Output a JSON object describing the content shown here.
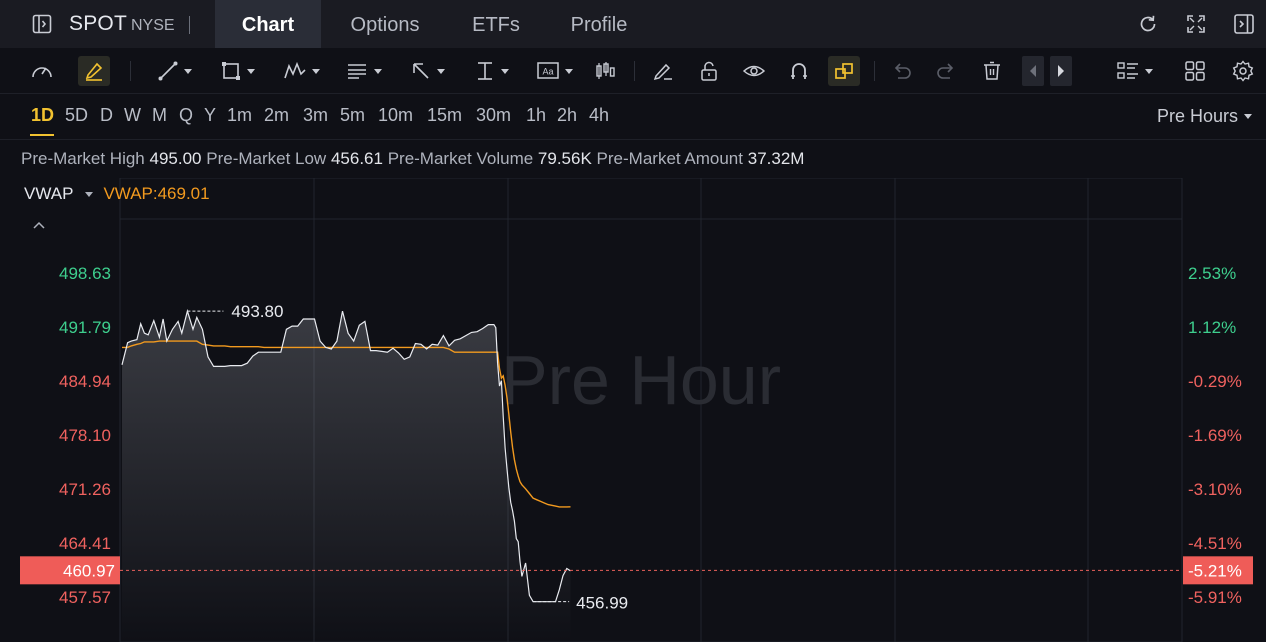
{
  "header": {
    "ticker": "SPOT",
    "exchange": "NYSE",
    "tabs": [
      {
        "label": "Chart",
        "active": true
      },
      {
        "label": "Options",
        "active": false
      },
      {
        "label": "ETFs",
        "active": false
      },
      {
        "label": "Profile",
        "active": false
      }
    ]
  },
  "toolbar": {
    "tools": [
      "speed-icon",
      "highlight-pen-icon",
      "line-icon",
      "rectangle-icon",
      "pattern-icon",
      "fib-icon",
      "arrow-icon",
      "measure-icon",
      "text-icon",
      "candles-icon",
      "brush-icon",
      "lock-icon",
      "eye-icon",
      "magnet-icon",
      "link-icon",
      "undo-icon",
      "redo-icon",
      "trash-icon",
      "prev-icon",
      "next-icon",
      "list-icon",
      "grid-icon",
      "settings-icon"
    ]
  },
  "timeframes": {
    "items": [
      "1D",
      "5D",
      "D",
      "W",
      "M",
      "Q",
      "Y",
      "1m",
      "2m",
      "3m",
      "5m",
      "10m",
      "15m",
      "30m",
      "1h",
      "2h",
      "4h"
    ],
    "active": "1D",
    "session": "Pre Hours"
  },
  "premarket": {
    "high_label": "Pre-Market High",
    "high": "495.00",
    "low_label": "Pre-Market Low",
    "low": "456.61",
    "volume_label": "Pre-Market Volume",
    "volume": "79.56K",
    "amount_label": "Pre-Market Amount",
    "amount": "37.32M"
  },
  "indicator": {
    "name": "VWAP",
    "value_text": "VWAP:469.01"
  },
  "chart_data": {
    "type": "line",
    "watermark": "Pre Hour",
    "y_ticks": [
      "498.63",
      "491.79",
      "484.94",
      "478.10",
      "471.26",
      "464.41",
      "457.57"
    ],
    "pct_ticks": [
      "2.53%",
      "1.12%",
      "-0.29%",
      "-1.69%",
      "-3.10%",
      "-4.51%",
      "-5.91%"
    ],
    "ylim": [
      455,
      503
    ],
    "ref_close": 486.33,
    "current_price": "460.97",
    "current_pct": "-5.21%",
    "high_annotation": "493.80",
    "low_annotation": "456.99",
    "colors": {
      "price": "#e9ebf0",
      "vwap": "#f29a1f",
      "up": "#3ecf8e",
      "down": "#f0625f",
      "grid": "#22252e"
    },
    "x": [
      0,
      3,
      5,
      8,
      10,
      12,
      14,
      17,
      20,
      22,
      24,
      27,
      30,
      32,
      35,
      38,
      40,
      43,
      46,
      49,
      52,
      55,
      58,
      61,
      64,
      67,
      70,
      73,
      76,
      79,
      82,
      85,
      88,
      91,
      94,
      97,
      100,
      103,
      106,
      109,
      112,
      115,
      118,
      121,
      124,
      127,
      130,
      133,
      136,
      139,
      142,
      145,
      148,
      151,
      154,
      157,
      160,
      163,
      166,
      169,
      172,
      175,
      178,
      181,
      184,
      187,
      190,
      193,
      196,
      199,
      200,
      201,
      202,
      203,
      204,
      205,
      206,
      207,
      208,
      209,
      210,
      211,
      212,
      213,
      214,
      216,
      218,
      220,
      222,
      224,
      226,
      228,
      230,
      232,
      234,
      236,
      238,
      240
    ],
    "price": [
      487.0,
      489.8,
      490.0,
      490.2,
      492.2,
      491.0,
      490.8,
      492.6,
      490.5,
      492.8,
      490.0,
      491.5,
      492.5,
      491.0,
      493.8,
      491.5,
      493.0,
      491.5,
      488.0,
      486.8,
      486.8,
      486.8,
      486.9,
      486.9,
      486.9,
      487.2,
      488.1,
      488.6,
      488.6,
      488.6,
      488.6,
      488.6,
      491.5,
      491.9,
      491.9,
      492.8,
      492.8,
      492.8,
      490.0,
      489.2,
      489.0,
      490.0,
      493.8,
      491.0,
      490.0,
      492.0,
      492.5,
      488.8,
      488.8,
      488.7,
      488.6,
      489.1,
      488.5,
      487.7,
      488.0,
      489.7,
      489.6,
      489.0,
      489.6,
      489.5,
      490.7,
      489.4,
      490.1,
      490.3,
      490.7,
      491.1,
      491.2,
      491.6,
      492.1,
      492.1,
      491.7,
      487.2,
      484.3,
      485.0,
      480.5,
      476.5,
      473.8,
      471.5,
      469.6,
      468.5,
      467.2,
      465.0,
      464.6,
      462.1,
      460.2,
      461.9,
      457.8,
      457.0,
      457.0,
      457.0,
      457.0,
      457.0,
      457.0,
      457.0,
      458.5,
      460.3,
      461.2,
      460.9
    ],
    "vwap": [
      489.2,
      489.2,
      489.4,
      489.6,
      489.7,
      489.9,
      489.9,
      489.9,
      490.0,
      490.0,
      490.0,
      490.0,
      490.0,
      490.0,
      490.0,
      490.0,
      490.0,
      489.6,
      489.5,
      489.4,
      489.4,
      489.4,
      489.3,
      489.3,
      489.3,
      489.3,
      489.3,
      489.3,
      489.2,
      489.2,
      489.2,
      489.2,
      489.2,
      489.2,
      489.2,
      489.2,
      489.2,
      489.2,
      489.2,
      489.2,
      489.2,
      489.2,
      489.2,
      489.2,
      489.2,
      489.2,
      489.2,
      489.2,
      489.2,
      489.2,
      489.2,
      489.2,
      489.2,
      489.2,
      489.2,
      489.2,
      489.2,
      489.2,
      489.2,
      489.2,
      489.2,
      489.0,
      488.6,
      488.6,
      488.6,
      488.6,
      488.6,
      488.6,
      488.6,
      488.6,
      488.6,
      488.6,
      486.5,
      485.3,
      485.6,
      484.4,
      482.8,
      480.8,
      478.5,
      476.5,
      475.0,
      473.8,
      472.9,
      472.2,
      471.8,
      471.3,
      470.7,
      470.1,
      469.9,
      469.7,
      469.5,
      469.3,
      469.2,
      469.1,
      469.0,
      469.0,
      469.0,
      469.01
    ]
  }
}
